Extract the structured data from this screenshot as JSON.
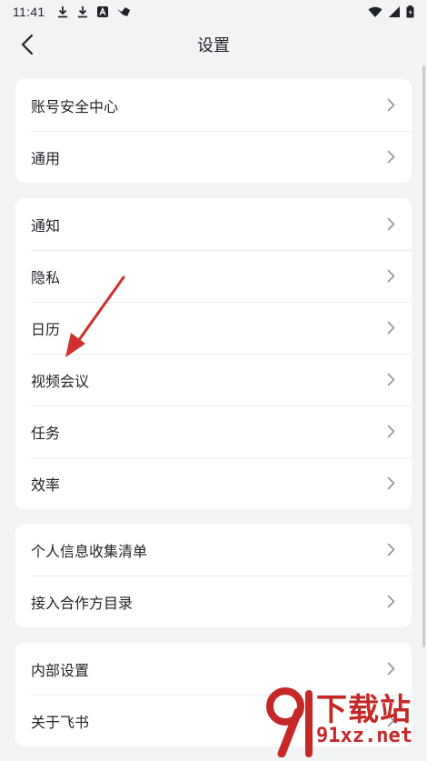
{
  "status_bar": {
    "time": "11:41",
    "left_icons": [
      "download-icon",
      "download-icon",
      "app-notification-icon",
      "cloud-app-icon"
    ],
    "right_icons": [
      "wifi-icon",
      "cellular-signal-icon",
      "battery-icon"
    ]
  },
  "nav": {
    "title": "设置",
    "back_icon": "back-arrow-icon"
  },
  "groups": [
    {
      "items": [
        {
          "label": "账号安全中心"
        },
        {
          "label": "通用"
        }
      ]
    },
    {
      "items": [
        {
          "label": "通知"
        },
        {
          "label": "隐私"
        },
        {
          "label": "日历"
        },
        {
          "label": "视频会议"
        },
        {
          "label": "任务"
        },
        {
          "label": "效率"
        }
      ]
    },
    {
      "items": [
        {
          "label": "个人信息收集清单"
        },
        {
          "label": "接入合作方目录"
        }
      ]
    },
    {
      "items": [
        {
          "label": "内部设置"
        },
        {
          "label": "关于飞书"
        }
      ]
    }
  ],
  "watermark": {
    "brand_text": "下载站",
    "domain_text": "91xz.net"
  },
  "colors": {
    "background": "#f2f3f5",
    "card": "#ffffff",
    "text": "#1f2329",
    "chevron": "#8f959e",
    "annotation_arrow": "#d32f2f",
    "watermark": "#c62828"
  }
}
